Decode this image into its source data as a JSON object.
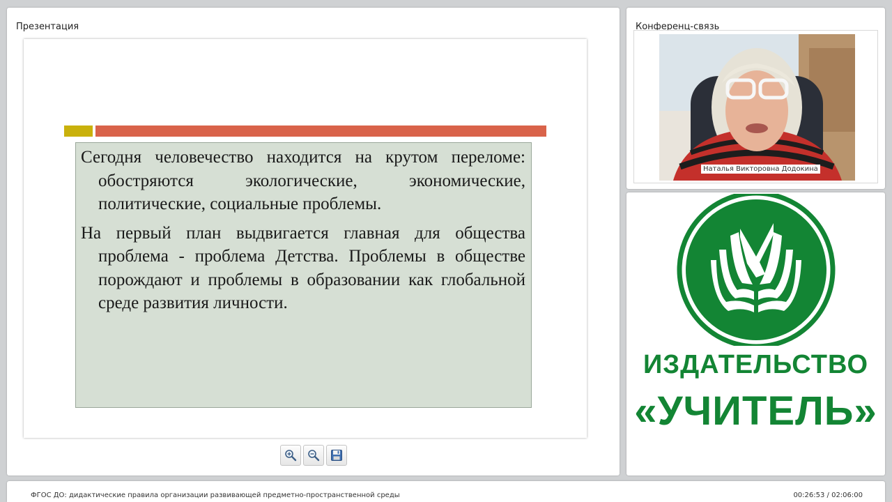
{
  "presentation": {
    "title": "Презентация",
    "slide": {
      "paragraphs": [
        "Сегодня человечество находится на крутом переломе: обостряются экологические, экономические, политические, социальные проблемы.",
        "На первый план выдвигается главная для общества проблема - проблема Детства. Проблемы в обществе порождают и проблемы в образовании как глобальной среде развития личности."
      ],
      "accent_colors": {
        "yellow": "#c9b10c",
        "orange": "#d9634a"
      },
      "box_background": "#d6dfd4"
    },
    "toolbar": {
      "buttons": [
        {
          "name": "zoom-in",
          "icon": "magnifier-plus-icon"
        },
        {
          "name": "zoom-out",
          "icon": "magnifier-minus-icon"
        },
        {
          "name": "save",
          "icon": "floppy-disk-icon"
        }
      ]
    }
  },
  "conference": {
    "title": "Конференц-связь",
    "participant_name": "Наталья Викторовна Додокина"
  },
  "logo": {
    "brand_color": "#138534",
    "publisher_word": "ИЗДАТЕЛЬСТВО",
    "publisher_name": "«УЧИТЕЛЬ»"
  },
  "status": {
    "webinar_title": "ФГОС ДО: дидактические правила организации развивающей предметно-пространственной среды",
    "elapsed": "00:26:53",
    "total": "02:06:00",
    "time_display": "00:26:53 / 02:06:00"
  }
}
